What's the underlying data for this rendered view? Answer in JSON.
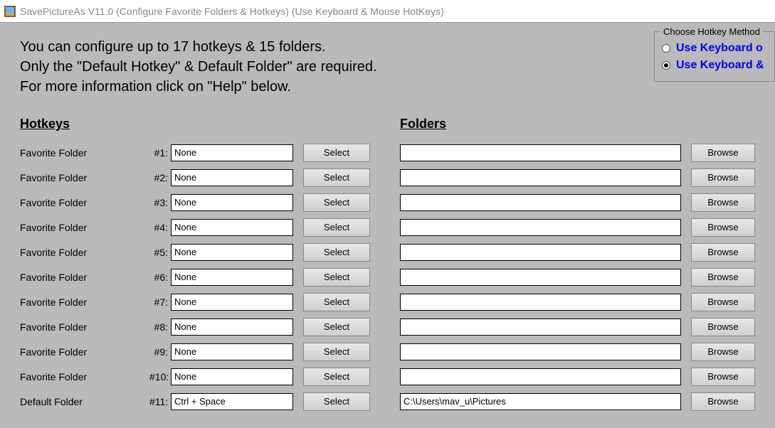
{
  "titlebar": {
    "text": "SavePictureAs V11.0 (Configure Favorite Folders & Hotkeys) (Use Keyboard & Mouse HotKeys)"
  },
  "intro": {
    "line1": "You can configure up to 17 hotkeys & 15 folders.",
    "line2": "Only the \"Default Hotkey\" & Default Folder\" are required.",
    "line3": "For more information click on \"Help\" below."
  },
  "hotkey_method": {
    "title": "Choose Hotkey Method",
    "opt1": "Use Keyboard o",
    "opt2": "Use Keyboard &"
  },
  "headers": {
    "hotkeys": "Hotkeys",
    "folders": "Folders"
  },
  "buttons": {
    "select": "Select",
    "browse": "Browse"
  },
  "rows": [
    {
      "label": "Favorite Folder",
      "num": "#1:",
      "hotkey": "None",
      "folder": ""
    },
    {
      "label": "Favorite Folder",
      "num": "#2:",
      "hotkey": "None",
      "folder": ""
    },
    {
      "label": "Favorite Folder",
      "num": "#3:",
      "hotkey": "None",
      "folder": ""
    },
    {
      "label": "Favorite Folder",
      "num": "#4:",
      "hotkey": "None",
      "folder": ""
    },
    {
      "label": "Favorite Folder",
      "num": "#5:",
      "hotkey": "None",
      "folder": ""
    },
    {
      "label": "Favorite Folder",
      "num": "#6:",
      "hotkey": "None",
      "folder": ""
    },
    {
      "label": "Favorite Folder",
      "num": "#7:",
      "hotkey": "None",
      "folder": ""
    },
    {
      "label": "Favorite Folder",
      "num": "#8:",
      "hotkey": "None",
      "folder": ""
    },
    {
      "label": "Favorite Folder",
      "num": "#9:",
      "hotkey": "None",
      "folder": ""
    },
    {
      "label": "Favorite Folder",
      "num": "#10:",
      "hotkey": "None",
      "folder": ""
    },
    {
      "label": "Default Folder",
      "num": "#11:",
      "hotkey": "Ctrl + Space",
      "folder": "C:\\Users\\mav_u\\Pictures"
    }
  ]
}
